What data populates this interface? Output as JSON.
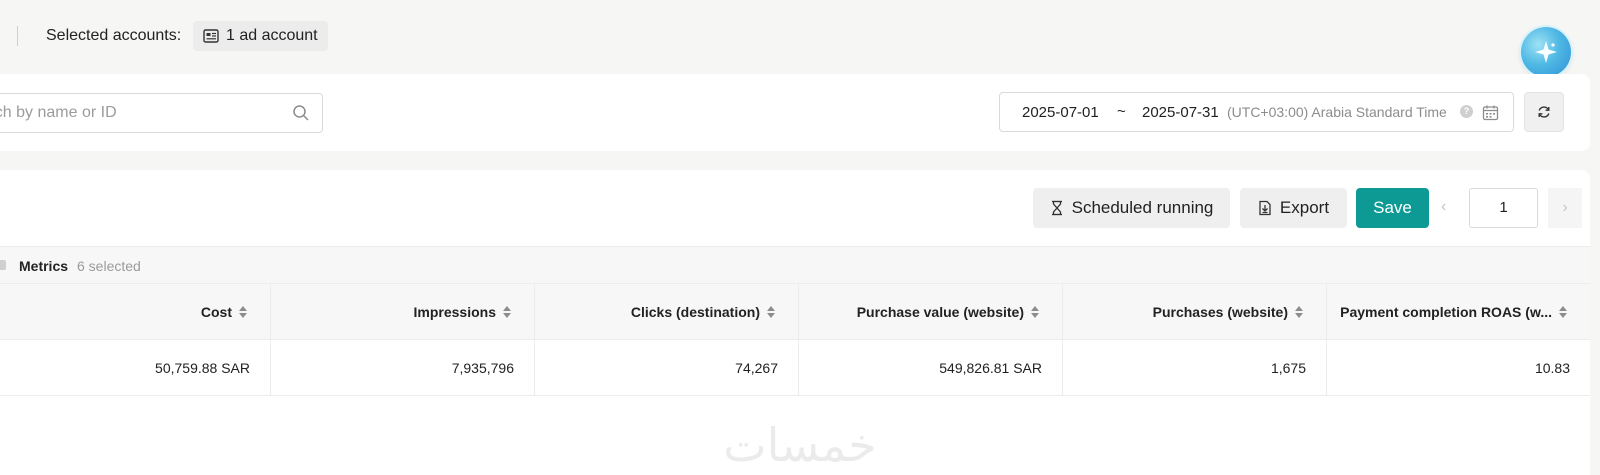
{
  "header": {
    "selected_label": "Selected accounts:",
    "account_chip": "1 ad account"
  },
  "filter": {
    "search_placeholder": "Search by name or ID",
    "date_start": "2025-07-01",
    "date_sep": "~",
    "date_end": "2025-07-31",
    "timezone": "(UTC+03:00) Arabia Standard Time",
    "help": "?"
  },
  "toolbar": {
    "scheduled_label": "Scheduled running",
    "export_label": "Export",
    "save_label": "Save",
    "page": "1",
    "prev": "‹",
    "next": "›"
  },
  "metrics": {
    "title": "Metrics",
    "count": "6 selected"
  },
  "table": {
    "columns": [
      "Cost",
      "Impressions",
      "Clicks (destination)",
      "Purchase value (website)",
      "Purchases (website)",
      "Payment completion ROAS (w..."
    ],
    "rows": [
      [
        "50,759.88 SAR",
        "7,935,796",
        "74,267",
        "549,826.81 SAR",
        "1,675",
        "10.83"
      ]
    ]
  },
  "colors": {
    "accent": "#0e9a94",
    "background": "#f6f6f5"
  },
  "watermark": "خمسات"
}
